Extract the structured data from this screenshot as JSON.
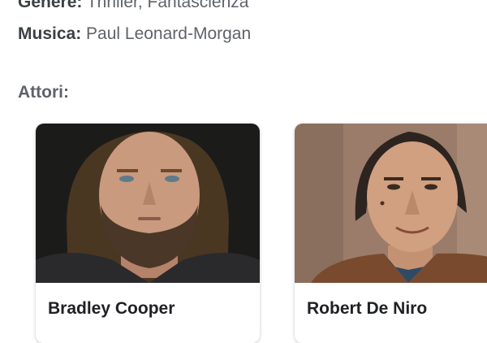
{
  "details": {
    "genre_label": "Genere:",
    "genre_value": "Thriller, Fantascienza",
    "music_label": "Musica:",
    "music_value": "Paul Leonard-Morgan"
  },
  "cast": {
    "title": "Attori:",
    "actors": [
      {
        "name": "Bradley Cooper"
      },
      {
        "name": "Robert De Niro"
      }
    ]
  }
}
